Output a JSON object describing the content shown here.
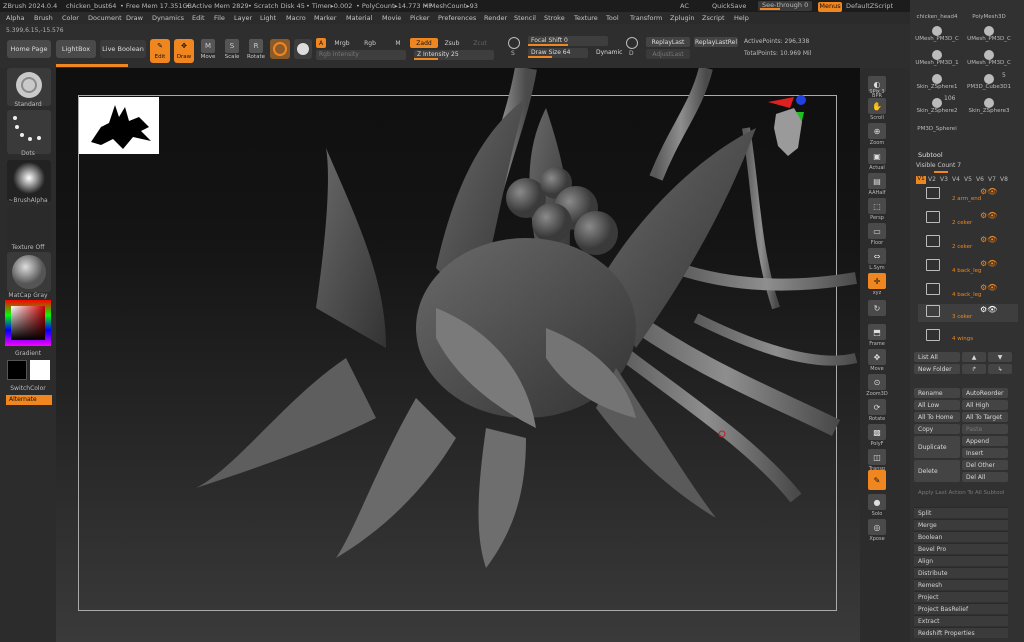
{
  "titlebar": {
    "app": "ZBrush 2024.0.4",
    "doc": "chicken_bust64",
    "free_mem": "• Free Mem 17.351GB",
    "active_mem": "• Active Mem 2829",
    "scratch": "• Scratch Disk 45",
    "timer": "• Timer▸0.002",
    "polycount": "• PolyCount▸14.773 MP",
    "meshcount": "• MeshCount▸93",
    "ac": "AC",
    "quicksave": "QuickSave",
    "see_through": "See-through   0",
    "menus": "Menus",
    "script": "DefaultZScript"
  },
  "menubar": [
    "Alpha",
    "Brush",
    "Color",
    "Document",
    "Draw",
    "Dynamics",
    "Edit",
    "File",
    "Layer",
    "Light",
    "Macro",
    "Marker",
    "Material",
    "Movie",
    "Picker",
    "Preferences",
    "Render",
    "Stencil",
    "Stroke",
    "Texture",
    "Tool",
    "Transform",
    "Zplugin",
    "Zscript",
    "Help"
  ],
  "shelf": {
    "coords": "5.399,6.15,-15.576",
    "home": "Home Page",
    "lightbox": "LightBox",
    "live_boolean": "Live Boolean",
    "edit": "Edit",
    "draw": "Draw",
    "move": "Move",
    "scale": "Scale",
    "rotate": "Rotate",
    "a": "A",
    "mrgb": "Mrgb",
    "rgb": "Rgb",
    "m": "M",
    "zadd": "Zadd",
    "zsub": "Zsub",
    "zcut": "Zcut",
    "rgb_intensity": "Rgb Intensity",
    "z_intensity": "Z Intensity 25",
    "focal_shift": "Focal Shift 0",
    "draw_size": "Draw Size 64",
    "dynamic": "Dynamic",
    "replay_last": "ReplayLast",
    "replay_last_rel": "ReplayLastRel",
    "adjust_last": "AdjustLast",
    "active_points": "ActivePoints: 296,338",
    "total_points": "TotalPoints: 10.969 Mil",
    "s": "S",
    "d": "D"
  },
  "left": {
    "standard": "Standard",
    "dots": "Dots",
    "brushalpha": "~BrushAlpha",
    "texture_off": "Texture Off",
    "matcap": "MatCap Gray",
    "gradient": "Gradient",
    "switchcolor": "SwitchColor",
    "alternate": "Alternate"
  },
  "rightcol": [
    {
      "label": "BPR",
      "icon": "◐"
    },
    {
      "label": "SPix 3",
      "icon": "▦"
    },
    {
      "label": "Scroll",
      "icon": "✋"
    },
    {
      "label": "Zoom",
      "icon": "⊕"
    },
    {
      "label": "Actual",
      "icon": "▣"
    },
    {
      "label": "AAHalf",
      "icon": "▤"
    },
    {
      "label": "Persp",
      "icon": "⬚"
    },
    {
      "label": "Floor",
      "icon": "▭"
    },
    {
      "label": "L.Sym",
      "icon": "⇔"
    },
    {
      "label": "xyz",
      "icon": "✛"
    },
    {
      "label": "",
      "icon": "↻"
    },
    {
      "label": "Frame",
      "icon": "⬒"
    },
    {
      "label": "Move",
      "icon": "✥"
    },
    {
      "label": "Zoom3D",
      "icon": "⊙"
    },
    {
      "label": "Rotate",
      "icon": "⟳"
    },
    {
      "label": "PolyF",
      "icon": "▩"
    },
    {
      "label": "Transp",
      "icon": "◫"
    },
    {
      "label": "",
      "icon": "✎"
    },
    {
      "label": "Solo",
      "icon": "●"
    },
    {
      "label": "Xpose",
      "icon": "◎"
    }
  ],
  "rightpanel": {
    "tools": [
      "chicken_head4",
      "PolyMesh3D",
      "UMesh_PM3D_C",
      "UMesh_PM3D_C",
      "UMesh_PM3D_1",
      "UMesh_PM3D_C",
      "Skin_ZSphere1",
      "PM3D_Cube3D1",
      "Skin_ZSphere2",
      "Skin_ZSphere3",
      "PM3D_Spherei"
    ],
    "tool_count_5": "5",
    "tool_count_106": "106",
    "subtool_title": "Subtool",
    "visible_count": "Visible Count 7",
    "versions": [
      "V1",
      "V2",
      "V3",
      "V4",
      "V5",
      "V6",
      "V7",
      "V8"
    ],
    "subtools": [
      {
        "num": "2",
        "name": "arm_end"
      },
      {
        "num": "2",
        "name": "ceker"
      },
      {
        "num": "2",
        "name": "ceker"
      },
      {
        "num": "4",
        "name": "back_leg"
      },
      {
        "num": "4",
        "name": "back_leg"
      },
      {
        "num": "3",
        "name": "ceker"
      },
      {
        "num": "4",
        "name": "wings"
      }
    ],
    "list_all": "List All",
    "new_folder": "New Folder",
    "rename": "Rename",
    "autoreorder": "AutoReorder",
    "all_low": "All Low",
    "all_high": "All High",
    "all_to_home": "All To Home",
    "all_to_target": "All To Target",
    "copy": "Copy",
    "paste": "Paste",
    "append": "Append",
    "duplicate": "Duplicate",
    "insert": "Insert",
    "delete": "Delete",
    "del_other": "Del Other",
    "del_all": "Del All",
    "apply_last": "Apply Last Action To All Subtool",
    "sections": [
      "Split",
      "Merge",
      "Boolean",
      "Bevel Pro",
      "Align",
      "Distribute",
      "Remesh",
      "Project",
      "Project BasRelief",
      "Extract",
      "Redshift Properties"
    ]
  },
  "colors": {
    "accent": "#f0861f",
    "panel": "#313131",
    "canvas_top": "#0f0f0f",
    "canvas_bottom": "#3a3a3a"
  }
}
